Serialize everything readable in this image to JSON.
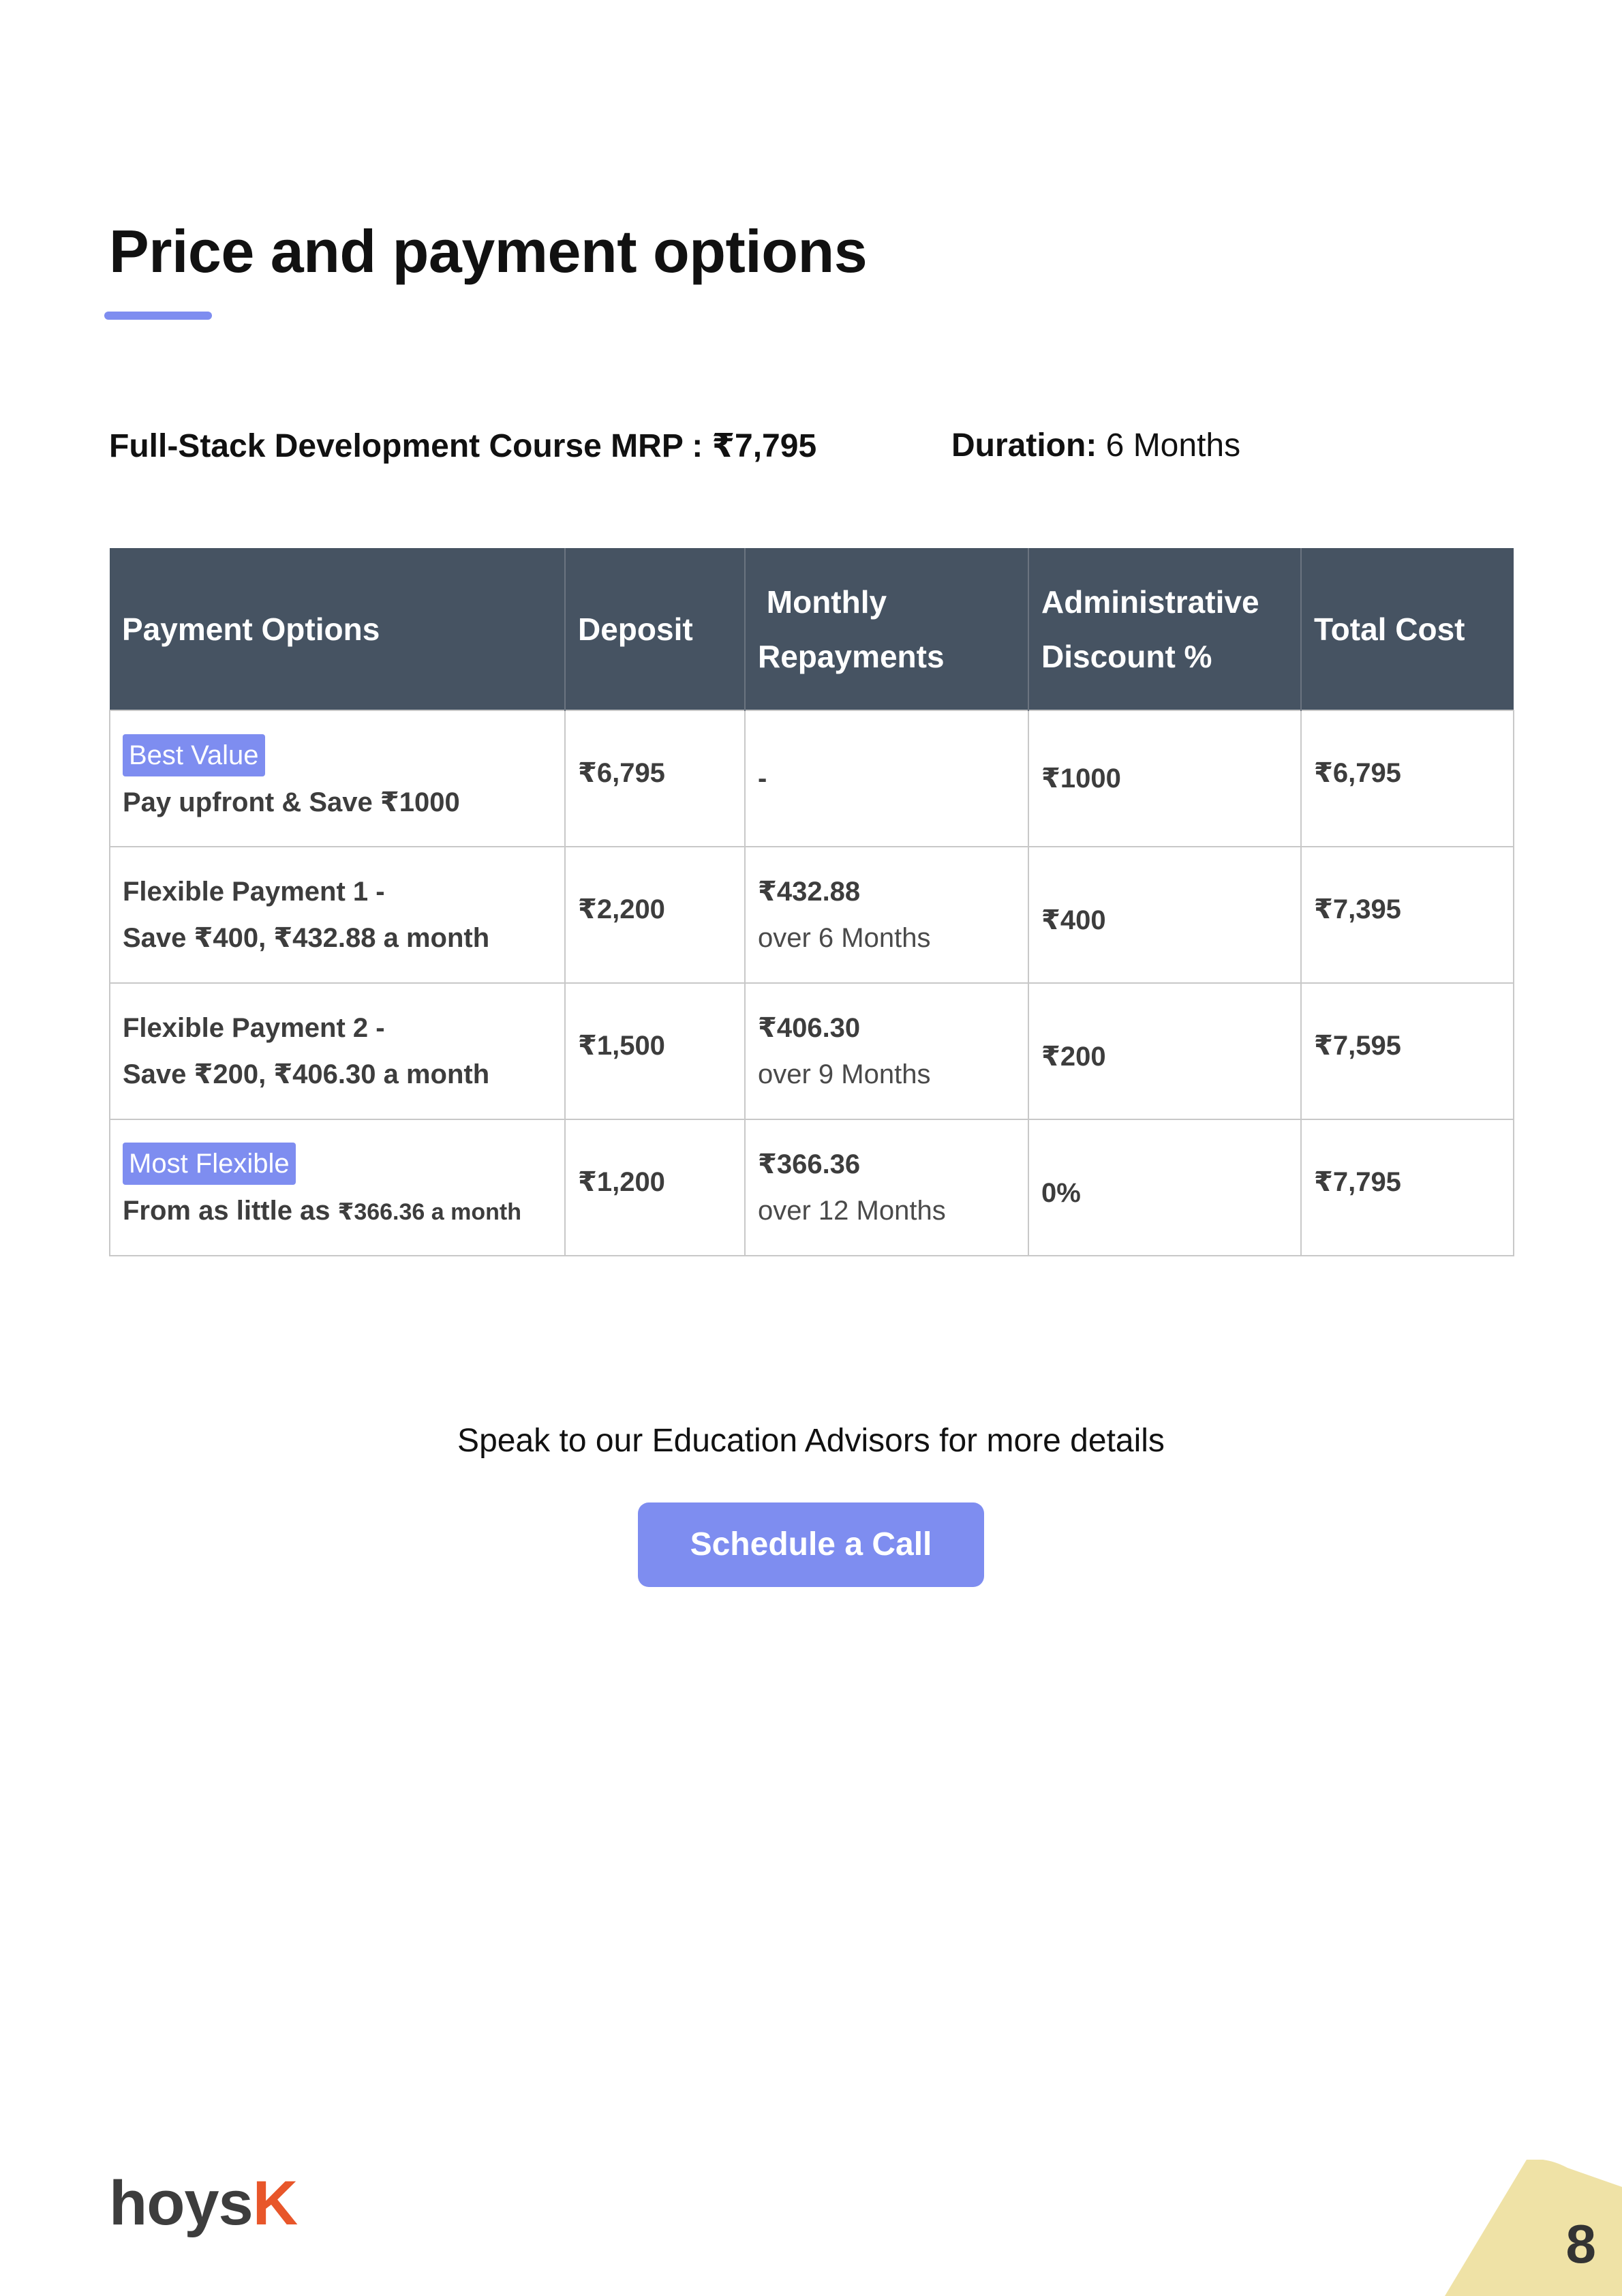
{
  "page": {
    "title": "Price and payment options",
    "course_label": "Full-Stack Development Course MRP : ₹7,795",
    "duration_label": "Duration:",
    "duration_value": "6 Months"
  },
  "table": {
    "headers": {
      "options": "Payment Options",
      "deposit": "Deposit",
      "monthly_1": "Monthly",
      "monthly_2": "Repayments",
      "admin_1": "Administrative",
      "admin_2": "Discount %",
      "total": "Total Cost"
    },
    "rows": [
      {
        "badge": "Best Value",
        "line1": "",
        "line2": "Pay upfront & Save ₹1000",
        "deposit": "₹6,795",
        "monthly_amount": "-",
        "monthly_period": "",
        "discount": "₹1000",
        "total": "₹6,795"
      },
      {
        "badge": "",
        "line1": "Flexible Payment 1 -",
        "line2": "Save ₹400, ₹432.88 a month",
        "deposit": "₹2,200",
        "monthly_amount": "₹432.88",
        "monthly_period": "over 6 Months",
        "discount": "₹400",
        "total": "₹7,395"
      },
      {
        "badge": "",
        "line1": "Flexible Payment 2 -",
        "line2": "Save ₹200, ₹406.30 a month",
        "deposit": "₹1,500",
        "monthly_amount": "₹406.30",
        "monthly_period": "over 9 Months",
        "discount": "₹200",
        "total": "₹7,595"
      },
      {
        "badge": "Most Flexible",
        "line1": "",
        "line2_a": "From as little as ",
        "line2_b": "₹366.36 a month",
        "deposit": "₹1,200",
        "monthly_amount": "₹366.36",
        "monthly_period": "over 12 Months",
        "discount": "0%",
        "total": "₹7,795"
      }
    ]
  },
  "cta": {
    "text": "Speak to our Education Advisors for more details",
    "button": "Schedule a Call"
  },
  "footer": {
    "logo_main": "hoys",
    "logo_accent": "K",
    "page_number": "8"
  },
  "colors": {
    "accent": "#7e8df0",
    "header_bg": "#465362",
    "logo_accent": "#e8562a",
    "corner": "#efe2a6"
  }
}
